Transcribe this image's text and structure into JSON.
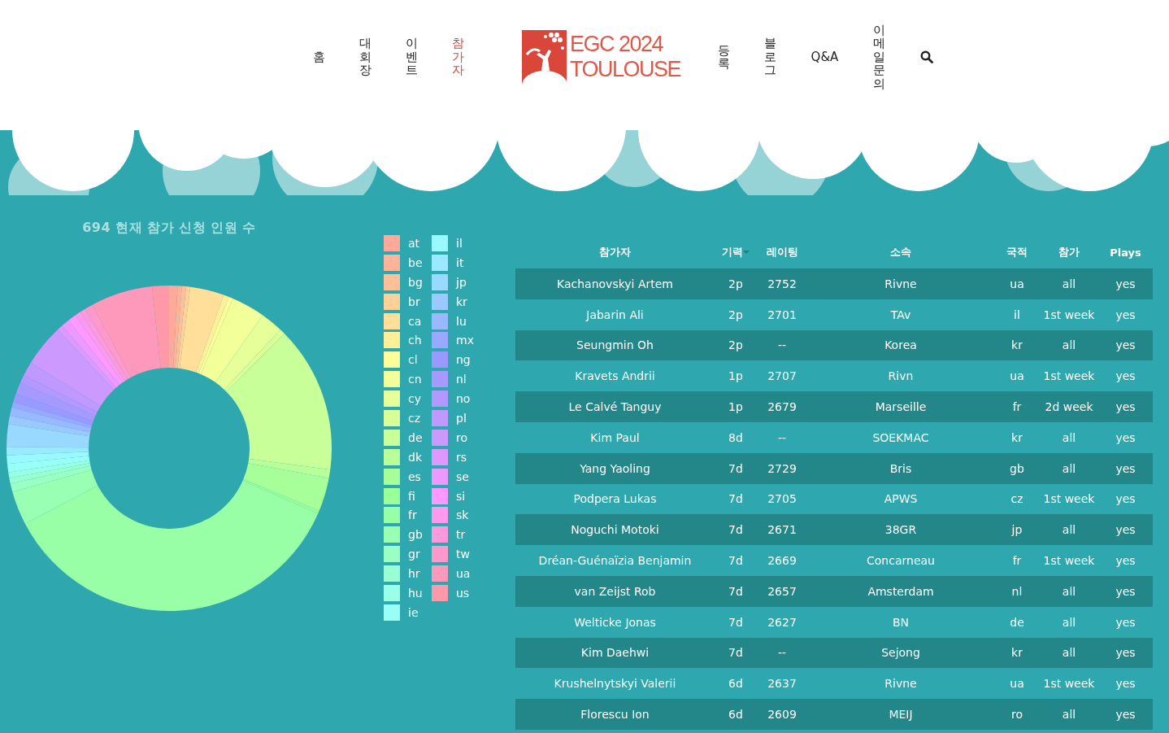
{
  "nav": {
    "items": [
      {
        "label": "홈",
        "kind": "vertical",
        "selected": false
      },
      {
        "label": "대회장",
        "kind": "vertical",
        "selected": false
      },
      {
        "label": "이벤트",
        "kind": "vertical",
        "selected": false
      },
      {
        "label": "참가자",
        "kind": "vertical",
        "selected": true
      }
    ],
    "logo": {
      "line_1": "EGC 2024",
      "line_2": "TOULOUSE"
    },
    "items_right": [
      {
        "label": "등록",
        "kind": "vertical",
        "selected": false
      },
      {
        "label": "블로그",
        "kind": "vertical",
        "selected": false
      },
      {
        "label": "Q&A",
        "kind": "horizontal",
        "selected": false
      },
      {
        "label": "이메일문의",
        "kind": "vertical",
        "selected": false
      }
    ]
  },
  "chart": {
    "title": "694 현재 참가 신청 인원 수"
  },
  "legend": {
    "items": [
      {
        "label": "at",
        "color": "#ffa99a"
      },
      {
        "label": "be",
        "color": "#ffb399"
      },
      {
        "label": "bg",
        "color": "#ffbf99"
      },
      {
        "label": "br",
        "color": "#ffd199"
      },
      {
        "label": "ca",
        "color": "#ffdf99"
      },
      {
        "label": "ch",
        "color": "#ffef99"
      },
      {
        "label": "cl",
        "color": "#ffff99"
      },
      {
        "label": "cn",
        "color": "#f3ff99"
      },
      {
        "label": "cy",
        "color": "#e6ff99"
      },
      {
        "label": "cz",
        "color": "#d9ff99"
      },
      {
        "label": "de",
        "color": "#c9ff99"
      },
      {
        "label": "dk",
        "color": "#b9ff99"
      },
      {
        "label": "es",
        "color": "#a6ff99"
      },
      {
        "label": "fi",
        "color": "#99ff99"
      },
      {
        "label": "fr",
        "color": "#99ffa6"
      },
      {
        "label": "gb",
        "color": "#99ffb3"
      },
      {
        "label": "gr",
        "color": "#99ffc3"
      },
      {
        "label": "hr",
        "color": "#99ffd3"
      },
      {
        "label": "hu",
        "color": "#99ffe6"
      },
      {
        "label": "ie",
        "color": "#99fff6"
      },
      {
        "label": "il",
        "color": "#99f9ff"
      },
      {
        "label": "it",
        "color": "#99e9ff"
      },
      {
        "label": "jp",
        "color": "#99d9ff"
      },
      {
        "label": "kr",
        "color": "#99c9ff"
      },
      {
        "label": "lu",
        "color": "#99b9ff"
      },
      {
        "label": "mx",
        "color": "#99a9ff"
      },
      {
        "label": "ng",
        "color": "#9999ff"
      },
      {
        "label": "nl",
        "color": "#a699ff"
      },
      {
        "label": "no",
        "color": "#b399ff"
      },
      {
        "label": "pl",
        "color": "#bf99ff"
      },
      {
        "label": "ro",
        "color": "#cc99ff"
      },
      {
        "label": "rs",
        "color": "#dd99ff"
      },
      {
        "label": "se",
        "color": "#ee99ff"
      },
      {
        "label": "si",
        "color": "#ff99ff"
      },
      {
        "label": "sk",
        "color": "#ff99ee"
      },
      {
        "label": "tr",
        "color": "#ff99dd"
      },
      {
        "label": "tw",
        "color": "#ff99cc"
      },
      {
        "label": "ua",
        "color": "#ff99bb"
      },
      {
        "label": "us",
        "color": "#ff99aa"
      }
    ]
  },
  "table": {
    "columns": [
      "참가자",
      "기력",
      "레이팅",
      "소속",
      "국적",
      "참가",
      "Plays"
    ],
    "rows": [
      [
        "Kachanovskyi Artem",
        "2p",
        "2752",
        "Rivne",
        "ua",
        "all",
        "yes"
      ],
      [
        "Jabarin Ali",
        "2p",
        "2701",
        "TAv",
        "il",
        "1st week",
        "yes"
      ],
      [
        "Seungmin Oh",
        "2p",
        "--",
        "Korea",
        "kr",
        "all",
        "yes"
      ],
      [
        "Kravets Andrii",
        "1p",
        "2707",
        "Rivn",
        "ua",
        "1st week",
        "yes"
      ],
      [
        "Le Calvé Tanguy",
        "1p",
        "2679",
        "Marseille",
        "fr",
        "2d week",
        "yes"
      ],
      [
        "Kim Paul",
        "8d",
        "--",
        "SOEKMAC",
        "kr",
        "all",
        "yes"
      ],
      [
        "Yang Yaoling",
        "7d",
        "2729",
        "Bris",
        "gb",
        "all",
        "yes"
      ],
      [
        "Podpera Lukas",
        "7d",
        "2705",
        "APWS",
        "cz",
        "1st week",
        "yes"
      ],
      [
        "Noguchi Motoki",
        "7d",
        "2671",
        "38GR",
        "jp",
        "all",
        "yes"
      ],
      [
        "Dréan-Guénaïzia Benjamin",
        "7d",
        "2669",
        "Concarneau",
        "fr",
        "1st week",
        "yes"
      ],
      [
        "van Zeijst Rob",
        "7d",
        "2657",
        "Amsterdam",
        "nl",
        "all",
        "yes"
      ],
      [
        "Welticke Jonas",
        "7d",
        "2627",
        "BN",
        "de",
        "all",
        "yes"
      ],
      [
        "Kim Daehwi",
        "7d",
        "--",
        "Sejong",
        "kr",
        "all",
        "yes"
      ],
      [
        "Krushelnytskyi Valerii",
        "6d",
        "2637",
        "Rivne",
        "ua",
        "1st week",
        "yes"
      ],
      [
        "Florescu Ion",
        "6d",
        "2609",
        "MEIJ",
        "ro",
        "all",
        "yes"
      ]
    ]
  }
}
